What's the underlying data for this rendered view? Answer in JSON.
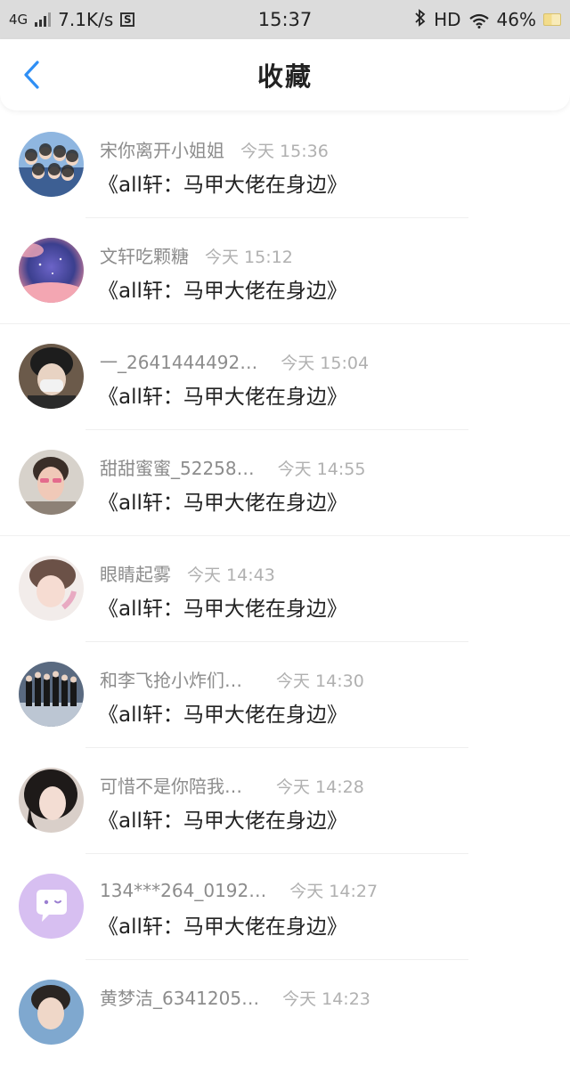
{
  "status_bar": {
    "network": "4G",
    "speed": "7.1K/s",
    "s_badge": "S",
    "time": "15:37",
    "hd": "HD",
    "battery": "46%"
  },
  "header": {
    "title": "收藏",
    "back_icon": "chevron-left-icon"
  },
  "items": [
    {
      "user": "宋你离开小姐姐",
      "time": "今天 15:36",
      "title": "《all轩：马甲大佬在身边》"
    },
    {
      "user": "文轩吃颗糖",
      "time": "今天 15:12",
      "title": "《all轩：马甲大佬在身边》"
    },
    {
      "user": "一_2641444492…",
      "time": "今天 15:04",
      "title": "《all轩：马甲大佬在身边》"
    },
    {
      "user": "甜甜蜜蜜_52258…",
      "time": "今天 14:55",
      "title": "《all轩：马甲大佬在身边》"
    },
    {
      "user": "眼睛起雾",
      "time": "今天 14:43",
      "title": "《all轩：马甲大佬在身边》"
    },
    {
      "user": "和李飞抢小炸们…",
      "time": "今天 14:30",
      "title": "《all轩：马甲大佬在身边》"
    },
    {
      "user": "可惜不是你陪我…",
      "time": "今天 14:28",
      "title": "《all轩：马甲大佬在身边》"
    },
    {
      "user": "134***264_0192…",
      "time": "今天 14:27",
      "title": "《all轩：马甲大佬在身边》"
    },
    {
      "user": "黄梦洁_6341205…",
      "time": "今天 14:23",
      "title": ""
    }
  ],
  "colors": {
    "accent": "#2f8ff5",
    "status_bar_bg": "#dcdcdc",
    "meta_text": "#8c8c8c",
    "time_text": "#b0b0b0",
    "divider": "#efefef"
  }
}
